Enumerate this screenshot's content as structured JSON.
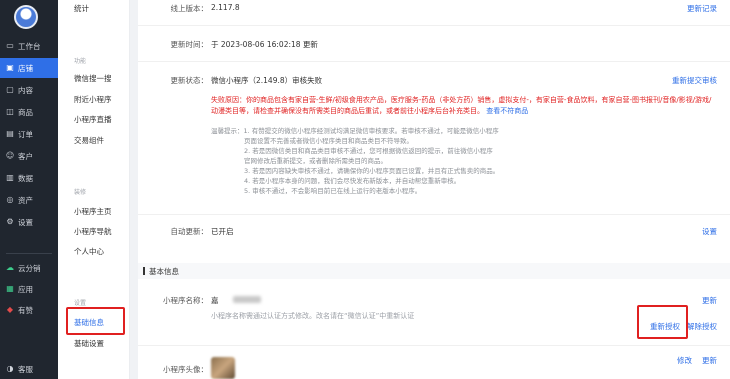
{
  "nav": {
    "items": [
      {
        "icon": "desktop-icon",
        "label": "工作台",
        "active": false
      },
      {
        "icon": "store-icon",
        "label": "店铺",
        "active": true
      },
      {
        "icon": "content-icon",
        "label": "内容",
        "active": false
      },
      {
        "icon": "product-icon",
        "label": "商品",
        "active": false
      },
      {
        "icon": "order-icon",
        "label": "订单",
        "active": false
      },
      {
        "icon": "customer-icon",
        "label": "客户",
        "active": false
      },
      {
        "icon": "data-icon",
        "label": "数据",
        "active": false
      },
      {
        "icon": "asset-icon",
        "label": "资产",
        "active": false
      },
      {
        "icon": "settings-icon",
        "label": "设置",
        "active": false
      }
    ],
    "apps": [
      {
        "icon": "cloud-icon",
        "label": "云分销"
      },
      {
        "icon": "apps-icon",
        "label": "应用"
      },
      {
        "icon": "youzan-icon",
        "label": "有赞"
      }
    ],
    "service": {
      "icon": "service-icon",
      "label": "客服"
    }
  },
  "subnav": {
    "top_item": "统计",
    "groups": [
      {
        "title": "功能",
        "items": [
          "微信搜一搜",
          "附近小程序",
          "小程序直播",
          "交易组件"
        ]
      },
      {
        "title": "装修",
        "items": [
          "小程序主页",
          "小程序导航",
          "个人中心"
        ]
      },
      {
        "title": "设置",
        "items": [
          "基础信息",
          "基础设置"
        ]
      }
    ],
    "active_item": "基础信息"
  },
  "main": {
    "online_version": {
      "label": "线上版本：",
      "value": "2.117.8",
      "link": "更新记录"
    },
    "update_time": {
      "label": "更新时间：",
      "value": "于 2023-08-06 16:02:18 更新"
    },
    "update_status": {
      "label": "更新状态：",
      "value": "微信小程序（2.149.8）审核失败",
      "link": "重新提交审核",
      "fail_reason_line1": "失败原因：你的商品包含有家自营-生鲜/初级食用农产品，医疗服务-药品（非处方药）销售，虚拟支付-，有家自营-食品饮料，有家自营-图书报刊/音像/影视/游戏/",
      "fail_reason_line2": "动漫类目等，请检查并确保没有所需类目的商品后重试，或者前往小程序后台补充类目。",
      "fail_reason_more": "查看不符商品",
      "tips": [
        "温馨提示：1. 有赞提交的微信小程序经测试均满足微信审核要求。若审核不通过，可能是微信小程序",
        "页面设置不完善或者微信小程序类目和商品类目不符导致。",
        "2. 若是因微信类目和商品类目审核不通过，您可根据微信返回的提示，前往微信小程序",
        "官网修改后重新提交，或者删除所需类目的商品。",
        "3. 若是因内容缺失审核不通过，请确保你的小程序页面已设置，并且有正式售卖的商品。",
        "4. 若是小程序本身的问题，我们会尽快发布新版本，并自动帮您重新审核。",
        "5. 审核不通过，不会影响目前已在线上运行的老版本小程序。"
      ]
    },
    "auto_update": {
      "label": "自动更新：",
      "value": "已开启",
      "link": "设置"
    },
    "section_title": "基本信息",
    "mini_name": {
      "label": "小程序名称：",
      "value_prefix": "嘉",
      "link_update": "更新",
      "hint": "小程序名称需通过认证方式修改。改名请在“微信认证”中重新认证",
      "link_reauth": "重新授权",
      "link_unbind": "解除授权"
    },
    "mini_avatar": {
      "label": "小程序头像：",
      "link_edit": "修改",
      "link_update": "更新"
    }
  },
  "colors": {
    "nav_bg": "#20262f",
    "accent": "#2f6fe7",
    "error": "#e02020"
  }
}
